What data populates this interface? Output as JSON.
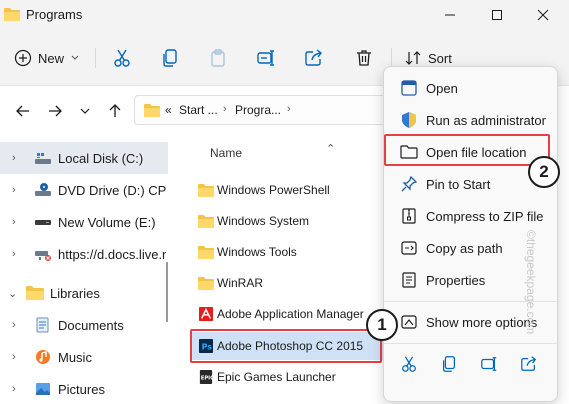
{
  "window": {
    "title": "Programs"
  },
  "toolbar": {
    "new_label": "New",
    "sort_label": "Sort"
  },
  "address": {
    "segments": [
      "Start ...",
      "Progra..."
    ],
    "overflow": "«"
  },
  "sidebar": {
    "items": [
      {
        "label": "Local Disk (C:)",
        "icon": "drive-icon",
        "selected": true
      },
      {
        "label": "DVD Drive (D:) CPR",
        "icon": "dvd-drive-icon"
      },
      {
        "label": "New Volume (E:)",
        "icon": "drive-icon"
      },
      {
        "label": "https://d.docs.live.n",
        "icon": "network-drive-icon"
      },
      {
        "label": "Libraries",
        "icon": "libraries-icon"
      },
      {
        "label": "Documents",
        "icon": "documents-icon"
      },
      {
        "label": "Music",
        "icon": "music-icon"
      },
      {
        "label": "Pictures",
        "icon": "pictures-icon"
      }
    ]
  },
  "filelist": {
    "column_name": "Name",
    "items": [
      {
        "name": "Windows PowerShell",
        "icon": "folder-icon"
      },
      {
        "name": "Windows System",
        "icon": "folder-icon"
      },
      {
        "name": "Windows Tools",
        "icon": "folder-icon"
      },
      {
        "name": "WinRAR",
        "icon": "folder-icon"
      },
      {
        "name": "Adobe Application Manager",
        "icon": "adobe-shortcut-icon"
      },
      {
        "name": "Adobe Photoshop CC 2015",
        "icon": "photoshop-shortcut-icon",
        "highlighted": true
      },
      {
        "name": "Epic Games Launcher",
        "icon": "epic-shortcut-icon"
      }
    ]
  },
  "context_menu": {
    "items": [
      {
        "label": "Open",
        "icon": "open-app-icon"
      },
      {
        "label": "Run as administrator",
        "icon": "admin-shield-icon"
      },
      {
        "label": "Open file location",
        "icon": "folder-outline-icon",
        "highlighted": true
      },
      {
        "label": "Pin to Start",
        "icon": "pin-icon"
      },
      {
        "label": "Compress to ZIP file",
        "icon": "zip-icon"
      },
      {
        "label": "Copy as path",
        "icon": "copy-path-icon"
      },
      {
        "label": "Properties",
        "icon": "properties-icon"
      },
      {
        "label": "Show more options",
        "icon": "more-options-icon"
      }
    ],
    "bottom_icons": [
      "cut-icon",
      "copy-icon",
      "rename-icon",
      "share-icon"
    ]
  },
  "callouts": [
    "1",
    "2"
  ],
  "watermark": "©thegeekpage.com",
  "colors": {
    "accent": "#0067c0",
    "callout_border": "#e34242",
    "selection": "#cfe2f5"
  }
}
